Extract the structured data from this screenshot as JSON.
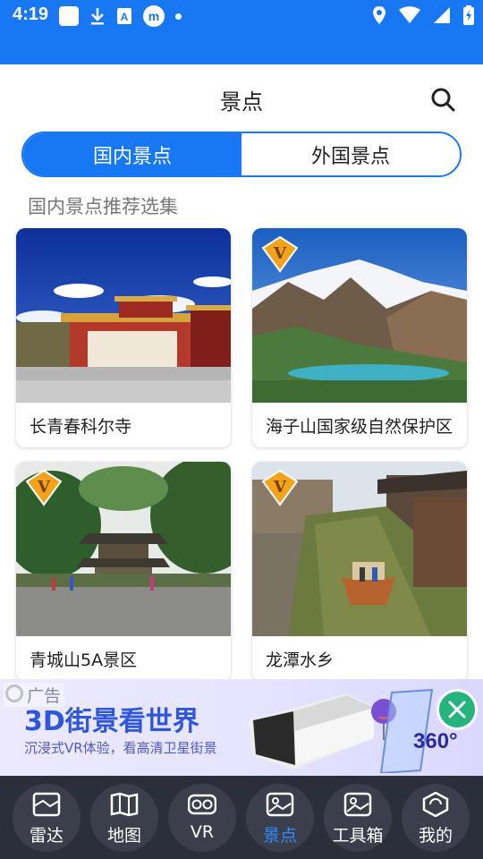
{
  "status_bar": {
    "time": "4:19",
    "m_badge": "m"
  },
  "header": {
    "title": "景点"
  },
  "segments": [
    {
      "label": "国内景点",
      "active": true
    },
    {
      "label": "外国景点",
      "active": false
    }
  ],
  "section": {
    "title": "国内景点推荐选集"
  },
  "cards": [
    {
      "label": "长青春科尔寺",
      "vip": false
    },
    {
      "label": "海子山国家级自然保护区",
      "vip": true
    },
    {
      "label": "青城山5A景区",
      "vip": true
    },
    {
      "label": "龙潭水乡",
      "vip": true
    }
  ],
  "ad": {
    "tag": "广告",
    "headline": "3D街景看世界",
    "subtitle": "沉浸式VR体验，看高清卫星街景",
    "badge_360": "360°"
  },
  "bottom_nav": [
    {
      "label": "雷达",
      "icon": "radar-map-icon",
      "active": false
    },
    {
      "label": "地图",
      "icon": "map-icon",
      "active": false
    },
    {
      "label": "VR",
      "icon": "vr-glasses-icon",
      "active": false
    },
    {
      "label": "景点",
      "icon": "scenery-icon",
      "active": true
    },
    {
      "label": "工具箱",
      "icon": "toolbox-icon",
      "active": false
    },
    {
      "label": "我的",
      "icon": "profile-icon",
      "active": false
    }
  ],
  "colors": {
    "primary": "#1877f2",
    "nav_bg": "#2a2f3a",
    "nav_active": "#2f8cff",
    "ad_close": "#25b47e"
  }
}
